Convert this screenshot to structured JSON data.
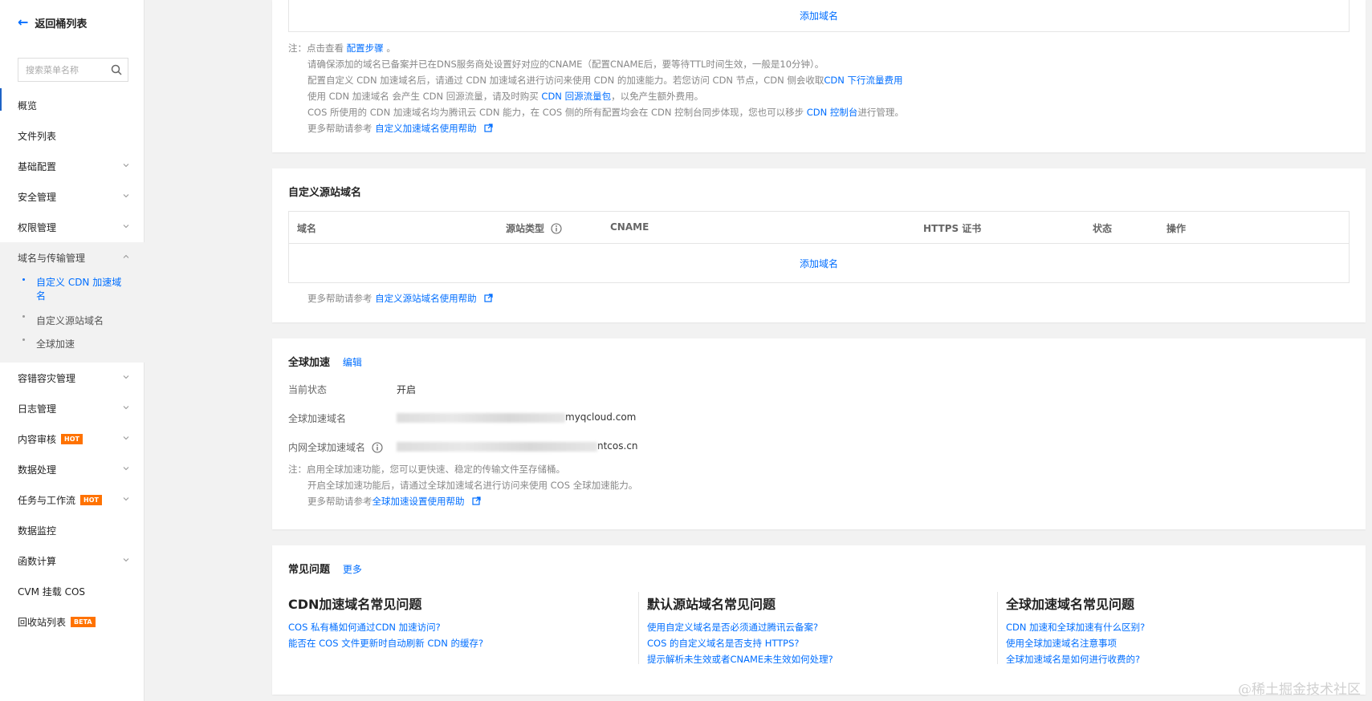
{
  "sidebar": {
    "back_label": "返回桶列表",
    "search_placeholder": "搜索菜单名称",
    "items": [
      {
        "label": "概览"
      },
      {
        "label": "文件列表"
      },
      {
        "label": "基础配置"
      },
      {
        "label": "安全管理"
      },
      {
        "label": "权限管理"
      },
      {
        "label": "域名与传输管理"
      },
      {
        "label": "容错容灾管理"
      },
      {
        "label": "日志管理"
      },
      {
        "label": "内容审核",
        "badge": "HOT"
      },
      {
        "label": "数据处理"
      },
      {
        "label": "任务与工作流",
        "badge": "HOT"
      },
      {
        "label": "数据监控"
      },
      {
        "label": "函数计算"
      },
      {
        "label": "CVM 挂载 COS"
      },
      {
        "label": "回收站列表",
        "badge": "BETA"
      }
    ],
    "subitems": [
      {
        "label": "自定义 CDN 加速域名"
      },
      {
        "label": "自定义源站域名"
      },
      {
        "label": "全球加速"
      }
    ]
  },
  "cdn_card": {
    "add_domain": "添加域名",
    "note_prefix": "注：",
    "note_line1_a": "点击查看",
    "note_line1_link": "配置步骤",
    "note_line1_b": "。",
    "note_line2": "请确保添加的域名已备案并已在DNS服务商处设置好对应的CNAME（配置CNAME后，要等待TTL时间生效，一般是10分钟）。",
    "note_line3_a": "配置自定义 CDN 加速域名后，请通过 CDN 加速域名进行访问来使用 CDN 的加速能力。若您访问 CDN 节点，CDN 侧会收取",
    "note_line3_link": "CDN 下行流量费用",
    "note_line4_a": "使用 CDN 加速域名 会产生 CDN 回源流量，请及时购买",
    "note_line4_link": "CDN 回源流量包",
    "note_line4_b": "，以免产生额外费用。",
    "note_line5_a": "COS 所使用的 CDN 加速域名均为腾讯云 CDN 能力，在 COS 侧的所有配置均会在 CDN 控制台同步体现，您也可以移步",
    "note_line5_link": "CDN 控制台",
    "note_line5_b": "进行管理。",
    "note_line6_a": "更多帮助请参考",
    "note_line6_link": "自定义加速域名使用帮助"
  },
  "origin_card": {
    "title": "自定义源站域名",
    "columns": [
      "域名",
      "源站类型",
      "CNAME",
      "HTTPS 证书",
      "状态",
      "操作"
    ],
    "add_domain": "添加域名",
    "help_a": "更多帮助请参考",
    "help_link": "自定义源站域名使用帮助"
  },
  "global_card": {
    "title": "全球加速",
    "edit": "编辑",
    "status_label": "当前状态",
    "status_value": "开启",
    "domain_label": "全球加速域名",
    "domain_value_tail": "myqcloud.com",
    "inner_label": "内网全球加速域名",
    "inner_value_tail": "ntcos.cn",
    "note_prefix": "注：",
    "note1": "启用全球加速功能，您可以更快速、稳定的传输文件至存储桶。",
    "note2": "开启全球加速功能后，请通过全球加速域名进行访问来使用 COS 全球加速能力。",
    "note3_a": "更多帮助请参考",
    "note3_link": "全球加速设置使用帮助"
  },
  "faq_card": {
    "title": "常见问题",
    "more": "更多",
    "columns": [
      {
        "heading": "CDN加速域名常见问题",
        "links": [
          "COS 私有桶如何通过CDN 加速访问?",
          "能否在 COS 文件更新时自动刷新 CDN 的缓存?"
        ]
      },
      {
        "heading": "默认源站域名常见问题",
        "links": [
          "使用自定义域名是否必须通过腾讯云备案?",
          "COS 的自定义域名是否支持 HTTPS?",
          "提示解析未生效或者CNAME未生效如何处理?"
        ]
      },
      {
        "heading": "全球加速域名常见问题",
        "links": [
          "CDN 加速和全球加速有什么区别?",
          "使用全球加速域名注意事项",
          "全球加速域名是如何进行收费的?"
        ]
      }
    ]
  },
  "watermark": "@稀土掘金技术社区",
  "colors": {
    "link": "#006eff",
    "hot": "#ff7200",
    "active_mark": "#1e63c6"
  }
}
